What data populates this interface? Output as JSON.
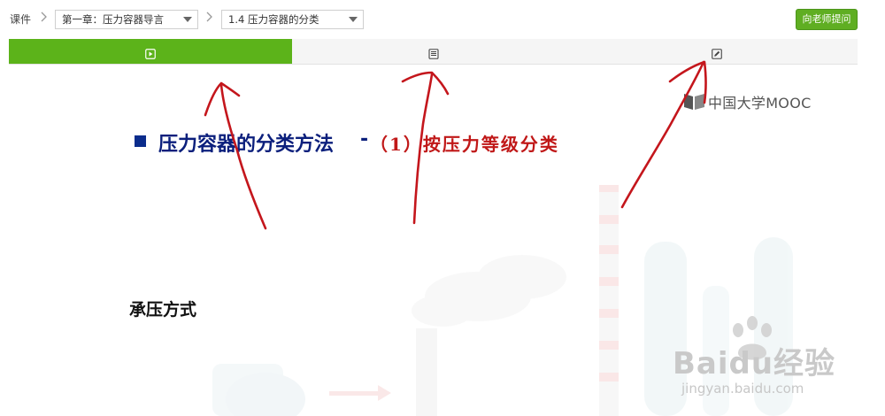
{
  "breadcrumb": {
    "root": "课件",
    "chapter_select": "第一章：压力容器导言",
    "section_select": "1.4 压力容器的分类"
  },
  "ask_button": "向老师提问",
  "tabs": [
    {
      "icon": "play-icon",
      "active": true
    },
    {
      "icon": "document-icon",
      "active": false
    },
    {
      "icon": "edit-icon",
      "active": false
    }
  ],
  "slide": {
    "logo_text": "中国大学MOOC",
    "heading_main": "压力容器的分类方法",
    "heading_dash": "-",
    "heading_highlight": "（1）按压力等级分类",
    "subheading": "承压方式"
  },
  "watermark": {
    "brand": "Baidu经验",
    "url": "jingyan.baidu.com"
  },
  "colors": {
    "accent_green": "#5cb31a",
    "heading_blue": "#0b1f7c",
    "highlight_red": "#c01818",
    "annotation_red": "#c4161c"
  }
}
